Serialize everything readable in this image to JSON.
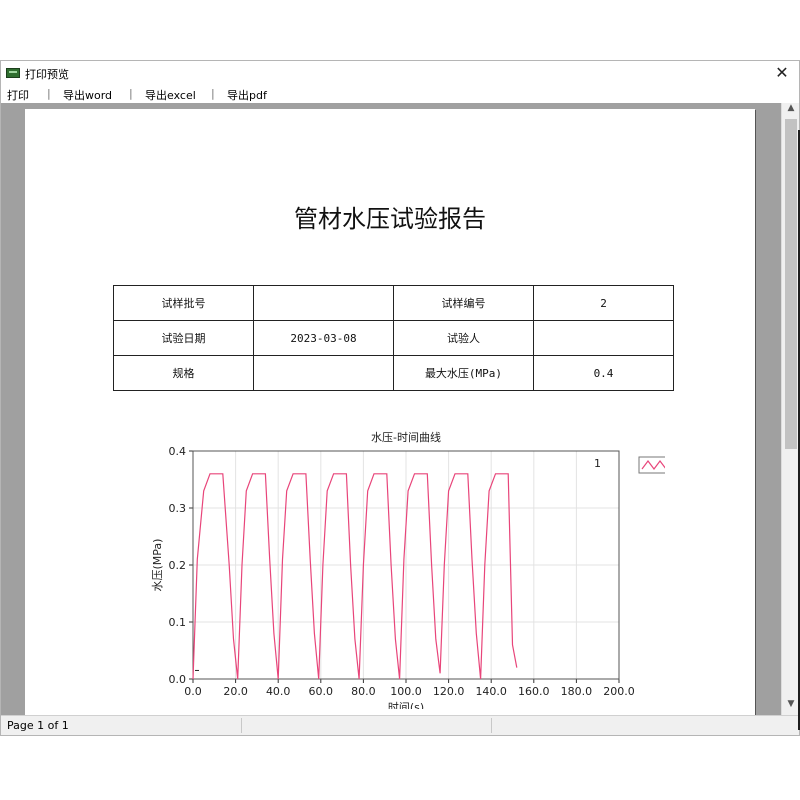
{
  "window": {
    "title": "打印预览",
    "close_glyph": "✕"
  },
  "menu": [
    "打印",
    "导出word",
    "导出excel",
    "导出pdf"
  ],
  "menu_separator": "|",
  "scrollbar": {
    "up_glyph": "▲",
    "down_glyph": "▼"
  },
  "report": {
    "title": "管材水压试验报告",
    "table": [
      [
        "试样批号",
        "",
        "试样编号",
        "2"
      ],
      [
        "试验日期",
        "2023-03-08",
        "试验人",
        ""
      ],
      [
        "规格",
        "",
        "最大水压(MPa)",
        "0.4"
      ]
    ]
  },
  "status": {
    "page_indicator": "Page 1 of 1"
  },
  "chart_data": {
    "type": "line",
    "title": "水压-时间曲线",
    "xlabel": "时间(s)",
    "ylabel": "水压(MPa)",
    "xlim": [
      0,
      200
    ],
    "ylim": [
      0,
      0.4
    ],
    "x_ticks": [
      "0.0",
      "20.0",
      "40.0",
      "60.0",
      "80.0",
      "100.0",
      "120.0",
      "140.0",
      "160.0",
      "180.0",
      "200.0"
    ],
    "y_ticks": [
      "0.0",
      "0.1",
      "0.2",
      "0.3",
      "0.4"
    ],
    "grid": true,
    "legend": {
      "position": "top-right",
      "entries": [
        "1"
      ]
    },
    "series": [
      {
        "name": "1",
        "color": "#e8457a",
        "x": [
          0,
          2,
          5,
          8,
          11,
          14,
          17,
          19,
          21,
          23,
          25,
          28,
          31,
          34,
          36,
          38,
          40,
          42,
          44,
          47,
          50,
          53,
          55,
          57,
          59,
          61,
          63,
          66,
          69,
          72,
          74,
          76,
          78,
          80,
          82,
          85,
          88,
          91,
          93,
          95,
          97,
          99,
          101,
          104,
          107,
          110,
          112,
          114,
          116,
          118,
          120,
          123,
          126,
          129,
          131,
          133,
          135,
          137,
          139,
          142,
          145,
          148,
          150,
          152
        ],
        "values": [
          0.0,
          0.21,
          0.33,
          0.36,
          0.36,
          0.36,
          0.2,
          0.07,
          0.0,
          0.2,
          0.33,
          0.36,
          0.36,
          0.36,
          0.21,
          0.08,
          0.0,
          0.21,
          0.33,
          0.36,
          0.36,
          0.36,
          0.21,
          0.08,
          0.0,
          0.2,
          0.33,
          0.36,
          0.36,
          0.36,
          0.2,
          0.07,
          0.0,
          0.2,
          0.33,
          0.36,
          0.36,
          0.36,
          0.2,
          0.07,
          0.0,
          0.21,
          0.33,
          0.36,
          0.36,
          0.36,
          0.2,
          0.07,
          0.01,
          0.2,
          0.33,
          0.36,
          0.36,
          0.36,
          0.21,
          0.08,
          0.0,
          0.2,
          0.33,
          0.36,
          0.36,
          0.36,
          0.06,
          0.02
        ]
      }
    ]
  }
}
